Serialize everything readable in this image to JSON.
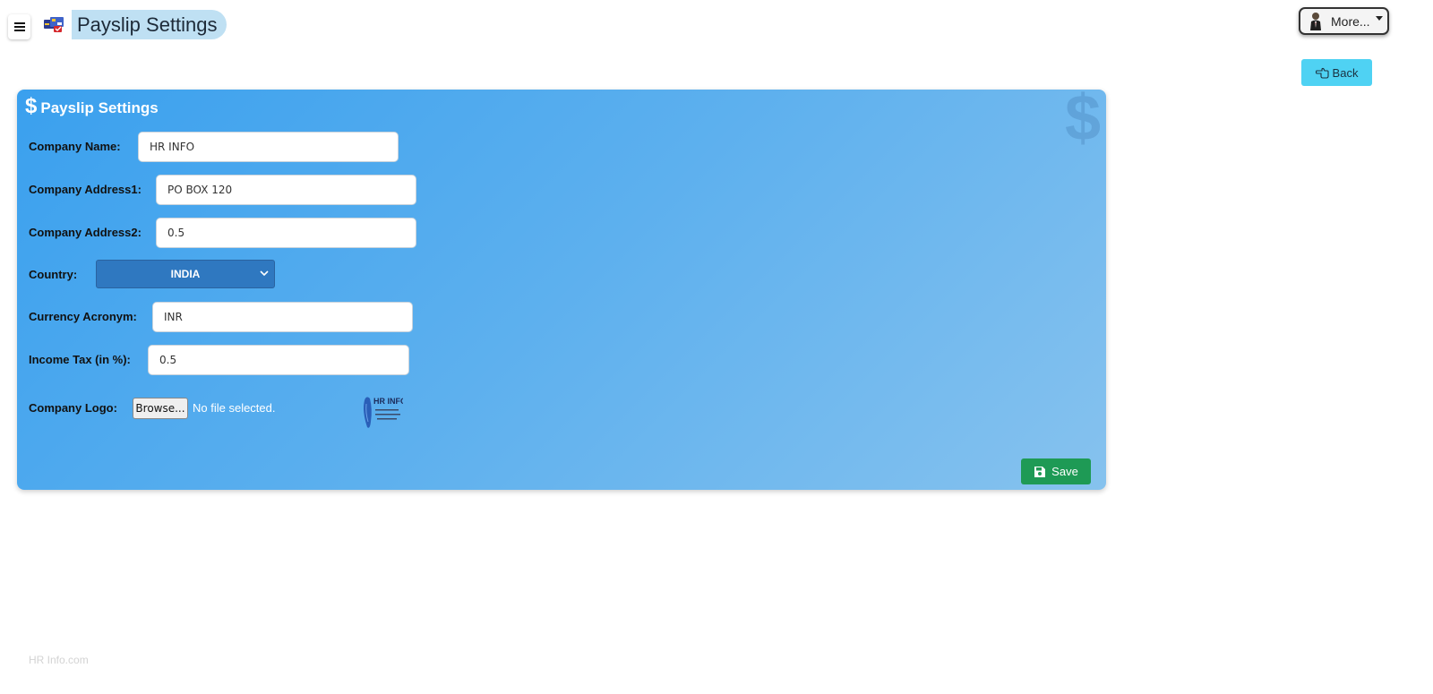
{
  "header": {
    "title": "Payslip Settings",
    "more_label": "More...",
    "back_label": "Back"
  },
  "form": {
    "title": "Payslip Settings",
    "title_symbol": "$",
    "watermark_symbol": "$",
    "company_name": {
      "label": "Company Name:",
      "value": "HR INFO"
    },
    "address1": {
      "label": "Company Address1:",
      "value": "PO BOX 120"
    },
    "address2": {
      "label": "Company Address2:",
      "value": "0.5"
    },
    "country": {
      "label": "Country:",
      "value": "INDIA"
    },
    "currency": {
      "label": "Currency Acronym:",
      "value": "INR"
    },
    "income_tax": {
      "label": "Income Tax (in %):",
      "value": "0.5"
    },
    "logo": {
      "label": "Company Logo:",
      "browse_label": "Browse...",
      "status": "No file selected.",
      "preview_text": "HR INFO"
    },
    "save_label": "Save"
  },
  "footer": {
    "text": "HR Info.com"
  },
  "colors": {
    "card_gradient_start": "#3aa0ee",
    "card_gradient_end": "#86c2ee",
    "back_button": "#4fd2f3",
    "save_button": "#1e9a55",
    "country_select": "#2f78c0",
    "title_highlight": "#bfe0f3"
  },
  "icons": {
    "menu": "hamburger-icon",
    "app": "payroll-cards-icon",
    "user": "user-avatar-icon",
    "back": "hand-pointing-left-icon",
    "save": "save-floppy-icon",
    "select": "chevron-down-icon"
  }
}
